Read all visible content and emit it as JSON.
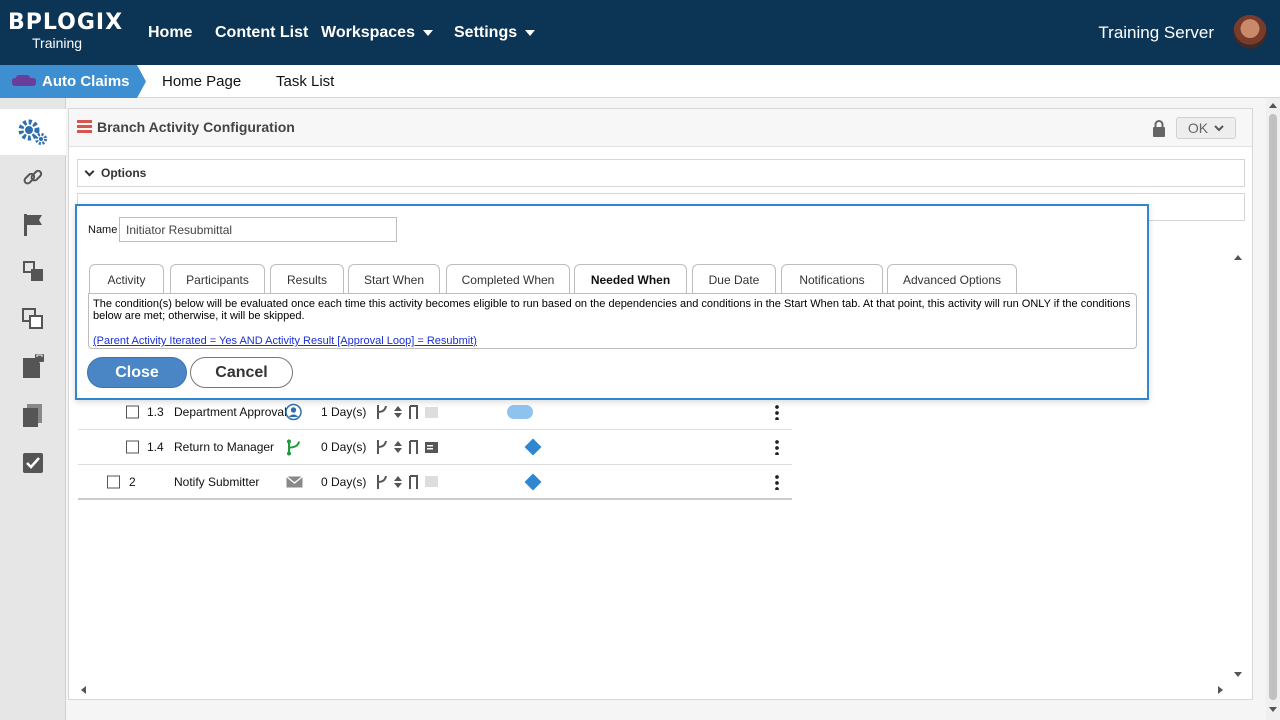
{
  "brand": {
    "logo_main": "BPLOGIX",
    "logo_sub": "Training"
  },
  "topnav": {
    "items": [
      {
        "label": "Home",
        "has_dropdown": false
      },
      {
        "label": "Content List",
        "has_dropdown": false
      },
      {
        "label": "Workspaces",
        "has_dropdown": true
      },
      {
        "label": "Settings",
        "has_dropdown": true
      }
    ],
    "server_label": "Training Server"
  },
  "subnav": {
    "app_label": "Auto Claims",
    "links": [
      "Home Page",
      "Task List"
    ]
  },
  "sidebar": {
    "icons": [
      "gears-icon",
      "link-icon",
      "flag-icon",
      "move-icon",
      "copy-icon",
      "locked-document-icon",
      "documents-icon",
      "checkbox-icon"
    ],
    "active_index": 0
  },
  "panel": {
    "title": "Branch Activity Configuration",
    "ok_label": "OK",
    "sections": [
      {
        "label": "Options"
      }
    ]
  },
  "activities": [
    {
      "number": "1.3",
      "name": "Department Approval",
      "type_icon": "user-icon",
      "duration": "1 Day(s)",
      "status": "pill"
    },
    {
      "number": "1.4",
      "name": "Return to Manager",
      "type_icon": "branch-icon",
      "duration": "0 Day(s)",
      "status": "diamond"
    },
    {
      "number": "2",
      "name": "Notify Submitter",
      "type_icon": "mail-icon",
      "duration": "0 Day(s)",
      "status": "diamond"
    }
  ],
  "dialog": {
    "name_label": "Name",
    "name_value": "Initiator Resubmittal",
    "tabs": [
      "Activity",
      "Participants",
      "Results",
      "Start When",
      "Completed When",
      "Needed When",
      "Due Date",
      "Notifications",
      "Advanced Options"
    ],
    "active_tab": "Needed When",
    "description": "The condition(s) below will be evaluated once each time this activity becomes eligible to run based on the dependencies and conditions in the Start When tab. At that point, this activity will run ONLY if the conditions below are met; otherwise, it will be skipped.",
    "condition_link": "(Parent Activity Iterated = Yes AND Activity Result [Approval Loop] = Resubmit)",
    "close_label": "Close",
    "cancel_label": "Cancel"
  },
  "colors": {
    "topbar": "#0c3555",
    "accent": "#2f86d1",
    "app_crumb": "#3d8fd1",
    "close_button": "#4a86c5"
  }
}
